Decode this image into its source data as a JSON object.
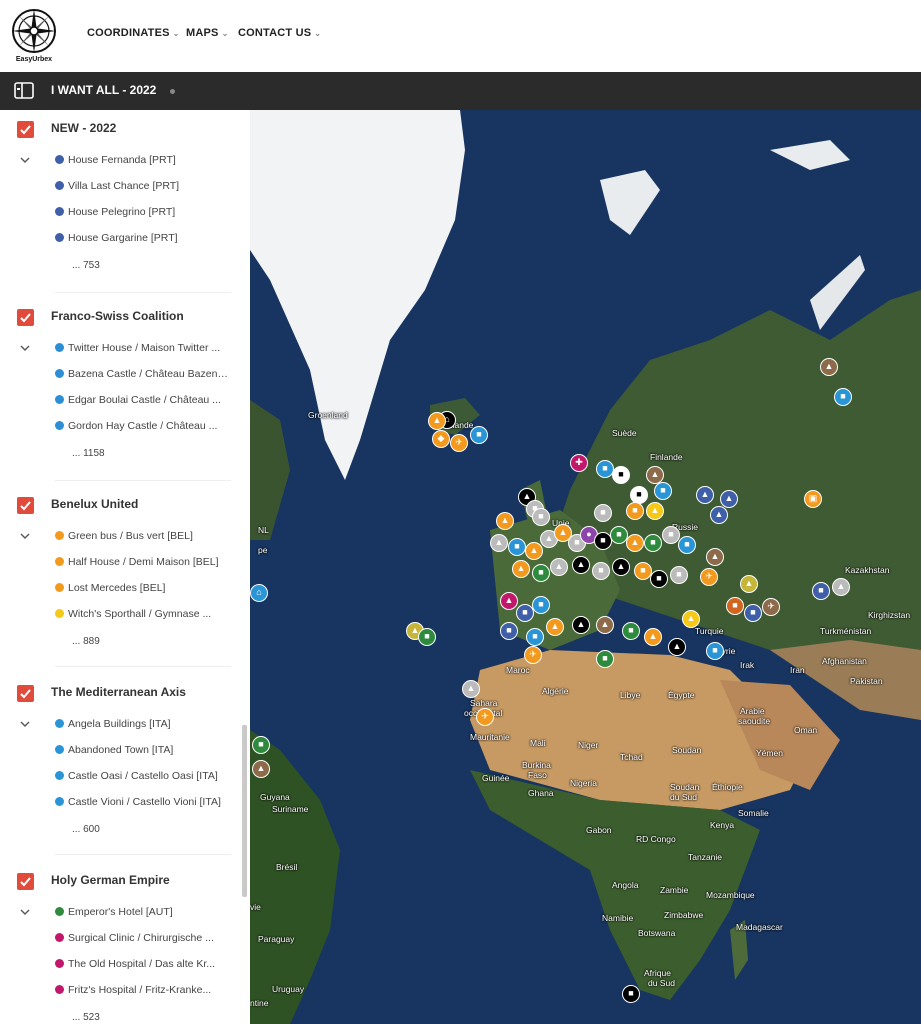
{
  "app": {
    "logo_text": "EasyUrbex"
  },
  "nav": {
    "coordinates": "COORDINATES",
    "maps": "MAPS",
    "contact": "CONTACT US"
  },
  "layer": {
    "title": "I WANT ALL - 2022"
  },
  "groups": [
    {
      "title": "NEW - 2022",
      "color": "#3f5fa8",
      "items": [
        "House Fernanda [PRT]",
        "Villa Last Chance [PRT]",
        "House Pelegrino [PRT]",
        "House Gargarine [PRT]"
      ],
      "more": "... 753"
    },
    {
      "title": "Franco-Swiss Coalition",
      "color": "#2c8fd6",
      "items": [
        "Twitter House / Maison Twitter ...",
        "Bazena Castle / Château Bazena ...",
        "Edgar Boulai Castle / Château ...",
        "Gordon Hay Castle / Château ..."
      ],
      "more": "... 1158"
    },
    {
      "title": "Benelux United",
      "color": "#f39a1e",
      "items": [
        "Green bus / Bus vert [BEL]",
        "Half House / Demi Maison [BEL]",
        "Lost Mercedes [BEL]",
        "Witch's Sporthall / Gymnase ..."
      ],
      "more": "... 889"
    },
    {
      "title": "The Mediterranean Axis",
      "color": "#2a95d6",
      "items": [
        "Angela Buildings [ITA]",
        "Abandoned Town [ITA]",
        "Castle Oasi / Castello Oasi [ITA]",
        "Castle Vioni / Castello Vioni [ITA]"
      ],
      "more": "... 600"
    },
    {
      "title": "Holy German Empire",
      "color": "#c2186b",
      "items": [
        "Emperor's Hotel [AUT]",
        "Surgical Clinic / Chirurgische ...",
        "The Old Hospital / Das alte Kr...",
        "Fritz's Hospital / Fritz-Kranke..."
      ],
      "more": "... 523"
    }
  ],
  "map_labels": {
    "groenland": "Groenland",
    "islande": "Islande",
    "suede": "Suède",
    "finlande": "Finlande",
    "russie": "Russie",
    "kazakhstan": "Kazakhstan",
    "kirghizstan": "Kirghizstan",
    "turkmenistan": "Turkménistan",
    "afghanistan": "Afghanistan",
    "pakistan": "Pakistan",
    "iran": "Iran",
    "irak": "Irak",
    "syrie": "Syrie",
    "turquie": "Turquie",
    "maroc": "Maroc",
    "algerie": "Algérie",
    "libye": "Libye",
    "egypte": "Égypte",
    "sahara": "Sahara",
    "occidental": "occidental",
    "mauritanie": "Mauritanie",
    "mali": "Mali",
    "niger": "Niger",
    "tchad": "Tchad",
    "soudan": "Soudan",
    "arabie": "Arabie",
    "saoudite": "saoudite",
    "oman": "Oman",
    "yemen": "Yémen",
    "guinee": "Guinée",
    "burkina": "Burkina",
    "faso": "Faso",
    "nigeria": "Nigeria",
    "ghana": "Ghana",
    "soudan_sud": "Soudan",
    "du_sud": "du Sud",
    "ethiopie": "Éthiopie",
    "somalie": "Somalie",
    "kenya": "Kenya",
    "gabon": "Gabon",
    "rd_congo": "RD Congo",
    "tanzanie": "Tanzanie",
    "angola": "Angola",
    "zambie": "Zambie",
    "mozambique": "Mozambique",
    "namibie": "Namibie",
    "zimbabwe": "Zimbabwe",
    "botswana": "Botswana",
    "madagascar": "Madagascar",
    "afrique": "Afrique",
    "afrique_du_sud": "du Sud",
    "guyana": "Guyana",
    "suriname": "Suriname",
    "bresil": "Brésil",
    "paraguay": "Paraguay",
    "uruguay": "Uruguay",
    "bolivie": "vie",
    "argentine": "ntine",
    "nl": "NL",
    "pe": "pe",
    "unie": "Unie"
  }
}
